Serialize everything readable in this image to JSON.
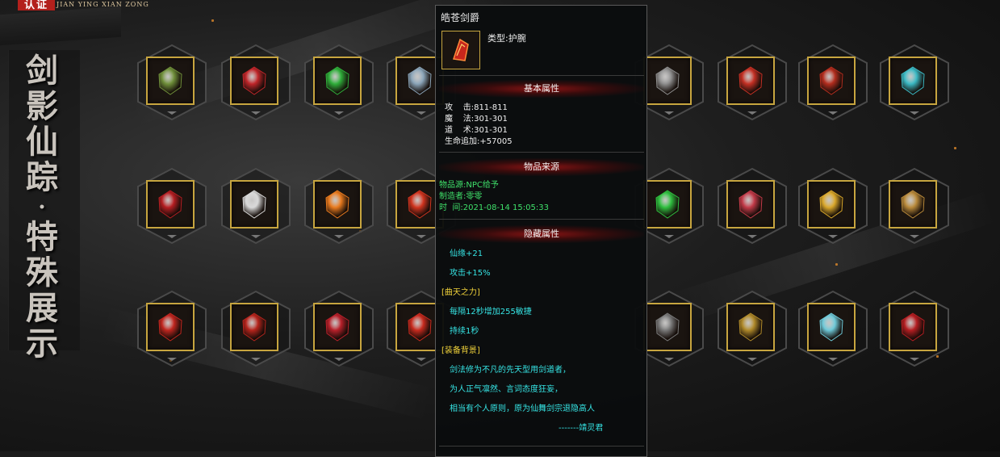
{
  "header": {
    "badge": "认证",
    "subtitle": "JIAN YING XIAN ZONG"
  },
  "side": {
    "title_top": [
      "剑",
      "影",
      "仙",
      "踪"
    ],
    "dot": "•",
    "title_bottom": [
      "特",
      "殊",
      "展",
      "示"
    ]
  },
  "grid": {
    "rows": [
      [
        {
          "icon": "jade-ring-icon",
          "color": "#6f8f3a"
        },
        {
          "icon": "red-crystal-icon",
          "color": "#c0262a"
        },
        {
          "icon": "green-armor-icon",
          "color": "#2fae3a"
        },
        {
          "icon": "silver-orb-icon",
          "color": "#8aa4b8"
        },
        null,
        {
          "icon": "grey-orb-icon",
          "color": "#8e8e8e"
        },
        {
          "icon": "red-orb-icon",
          "color": "#c43024"
        },
        {
          "icon": "red-gem-plate-icon",
          "color": "#b32d1e"
        },
        {
          "icon": "cyan-gem-plate-icon",
          "color": "#3bb9c4"
        }
      ],
      [
        {
          "icon": "red-helmet-icon",
          "color": "#b51e22"
        },
        {
          "icon": "white-claw-icon",
          "color": "#d8d8d8"
        },
        {
          "icon": "flame-blade-icon",
          "color": "#e87a1e"
        },
        {
          "icon": "red-bracer-icon",
          "color": "#d0341f"
        },
        null,
        {
          "icon": "green-claw-icon",
          "color": "#2fbf3f"
        },
        {
          "icon": "red-wing-emblem-icon",
          "color": "#c23a48"
        },
        {
          "icon": "gold-emblem-icon",
          "color": "#d9a72a"
        },
        {
          "icon": "dragon-medal-icon",
          "color": "#b8893a"
        }
      ],
      [
        {
          "icon": "red-bracelet-icon",
          "color": "#c1261f"
        },
        {
          "icon": "fire-ring-icon",
          "color": "#b5241c"
        },
        {
          "icon": "crimson-claw-icon",
          "color": "#b8202a"
        },
        {
          "icon": "red-wings-icon",
          "color": "#c82a1e"
        },
        null,
        {
          "icon": "dark-gauntlet-icon",
          "color": "#7a7a7a"
        },
        {
          "icon": "gold-gauntlet-icon",
          "color": "#b08a2a"
        },
        {
          "icon": "jeweled-staff-icon",
          "color": "#6ec9d8"
        },
        {
          "icon": "red-mask-icon",
          "color": "#b51e22"
        }
      ]
    ]
  },
  "tooltip": {
    "name": "皓苍剑爵",
    "type_line": "类型:护腕",
    "sections": {
      "basic": "基本属性",
      "source": "物品来源",
      "hidden": "隐藏属性"
    },
    "basic_lines": [
      "攻    击:811-811",
      "魔    法:301-301",
      "道    术:301-301",
      "生命追加:+57005"
    ],
    "source_lines": [
      "物品源:NPC给予",
      "制造者:零零",
      "时  间:2021-08-14 15:05:33"
    ],
    "hidden_lines": [
      {
        "text": "仙缘+21",
        "style": "c"
      },
      {
        "text": "攻击+15%",
        "style": "c"
      },
      {
        "text": "[曲天之力]",
        "style": "y"
      },
      {
        "text": "每隔12秒增加255敏捷",
        "style": "c"
      },
      {
        "text": "持续1秒",
        "style": "c"
      },
      {
        "text": "[装备背景]",
        "style": "y"
      },
      {
        "text": "剑法修为不凡的先天型用剑道者，",
        "style": "c"
      },
      {
        "text": "为人正气凛然、言词态度狂妄，",
        "style": "c"
      },
      {
        "text": "相当有个人原则，原为仙舞剑宗退隐高人",
        "style": "c"
      },
      {
        "text": "-------靖灵君",
        "style": "c"
      }
    ]
  }
}
